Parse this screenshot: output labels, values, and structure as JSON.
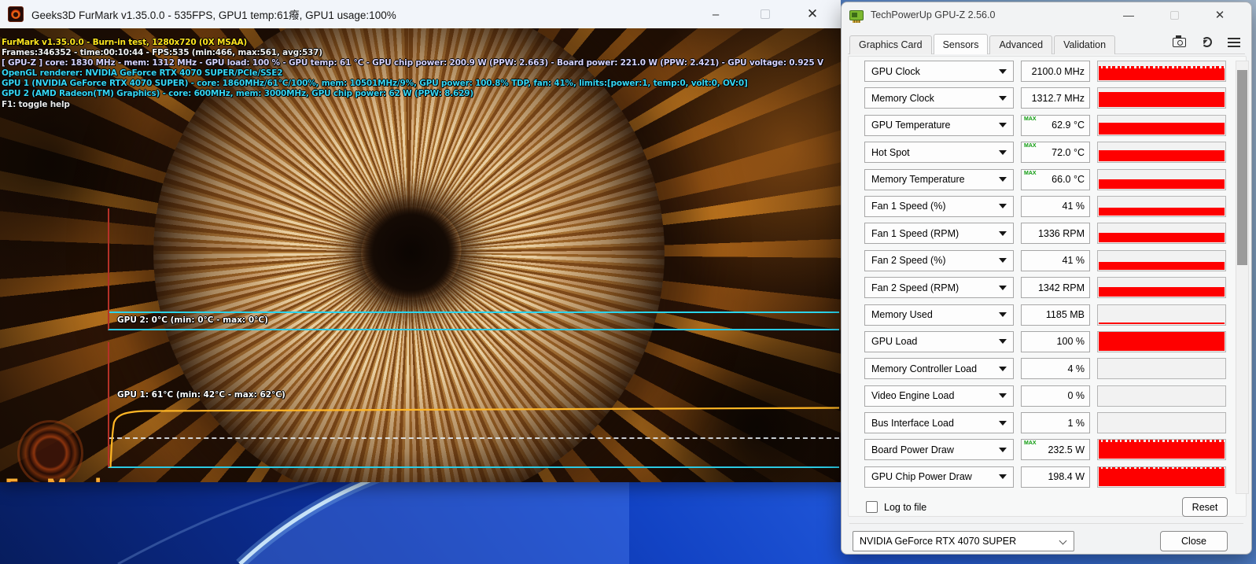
{
  "furmark": {
    "window_title": "Geeks3D FurMark v1.35.0.0 - 535FPS, GPU1 temp:61癈, GPU1 usage:100%",
    "overlay_lines": [
      {
        "text": "FurMark v1.35.0.0 - Burn-in test, 1280x720 (0X MSAA)",
        "color": "#ffe51e"
      },
      {
        "text": "Frames:346352 - time:00:10:44 - FPS:535 (min:466, max:561, avg:537)",
        "color": "#f2f2f2"
      },
      {
        "text": "[ GPU-Z ] core: 1830 MHz - mem: 1312 MHz - GPU load: 100 % - GPU temp: 61 °C - GPU chip power: 200.9 W (PPW: 2.663) - Board power: 221.0 W (PPW: 2.421) - GPU voltage: 0.925 V",
        "color": "#d6d3ff"
      },
      {
        "text": "OpenGL renderer: NVIDIA GeForce RTX 4070 SUPER/PCIe/SSE2",
        "color": "#35d6f4"
      },
      {
        "text": "GPU 1 (NVIDIA GeForce RTX 4070 SUPER) - core: 1860MHz/61°C/100%, mem: 10501MHz/9%, GPU power: 100.8% TDP, fan: 41%, limits:[power:1, temp:0, volt:0, OV:0]",
        "color": "#35d6f4"
      },
      {
        "text": "GPU 2 (AMD Radeon(TM) Graphics) - core: 600MHz, mem: 3000MHz, GPU chip power: 62 W (PPW: 8.629)",
        "color": "#35d6f4"
      },
      {
        "text": "F1: toggle help",
        "color": "#e8e8e8"
      }
    ],
    "gpu2_graph_label": "GPU 2: 0°C (min: 0°C - max: 0°C)",
    "gpu1_graph_label": "GPU 1: 61°C (min: 42°C - max: 62°C)",
    "logo_text": "FurMark"
  },
  "gpuz": {
    "window_title": "TechPowerUp GPU-Z 2.56.0",
    "tabs": [
      "Graphics Card",
      "Sensors",
      "Advanced",
      "Validation"
    ],
    "active_tab": "Sensors",
    "max_badge": "MAX",
    "graph_color": "#fe0000",
    "max_badge_color": "#0f9b0f",
    "sensors": [
      {
        "label": "GPU Clock",
        "value": "2100.0 MHz",
        "max": false,
        "fill": 62,
        "jagged": true
      },
      {
        "label": "Memory Clock",
        "value": "1312.7 MHz",
        "max": false,
        "fill": 78,
        "jagged": false
      },
      {
        "label": "GPU Temperature",
        "value": "62.9 °C",
        "max": true,
        "fill": 58,
        "jagged": false
      },
      {
        "label": "Hot Spot",
        "value": "72.0 °C",
        "max": true,
        "fill": 57,
        "jagged": false
      },
      {
        "label": "Memory Temperature",
        "value": "66.0 °C",
        "max": true,
        "fill": 47,
        "jagged": false
      },
      {
        "label": "Fan 1 Speed (%)",
        "value": "41 %",
        "max": false,
        "fill": 40,
        "jagged": false
      },
      {
        "label": "Fan 1 Speed (RPM)",
        "value": "1336 RPM",
        "max": false,
        "fill": 50,
        "jagged": false
      },
      {
        "label": "Fan 2 Speed (%)",
        "value": "41 %",
        "max": false,
        "fill": 40,
        "jagged": false
      },
      {
        "label": "Fan 2 Speed (RPM)",
        "value": "1342 RPM",
        "max": false,
        "fill": 48,
        "jagged": false
      },
      {
        "label": "Memory Used",
        "value": "1185 MB",
        "max": false,
        "fill": 8,
        "jagged": false
      },
      {
        "label": "GPU Load",
        "value": "100 %",
        "max": false,
        "fill": 100,
        "jagged": false
      },
      {
        "label": "Memory Controller Load",
        "value": "4 %",
        "max": false,
        "fill": 0,
        "jagged": false
      },
      {
        "label": "Video Engine Load",
        "value": "0 %",
        "max": false,
        "fill": 0,
        "jagged": false
      },
      {
        "label": "Bus Interface Load",
        "value": "1 %",
        "max": false,
        "fill": 0,
        "jagged": false
      },
      {
        "label": "Board Power Draw",
        "value": "232.5 W",
        "max": true,
        "fill": 86,
        "jagged": true
      },
      {
        "label": "GPU Chip Power Draw",
        "value": "198.4 W",
        "max": false,
        "fill": 86,
        "jagged": true
      }
    ],
    "log_label": "Log to file",
    "reset_label": "Reset",
    "gpu_selector_value": "NVIDIA GeForce RTX 4070 SUPER",
    "close_label": "Close"
  }
}
